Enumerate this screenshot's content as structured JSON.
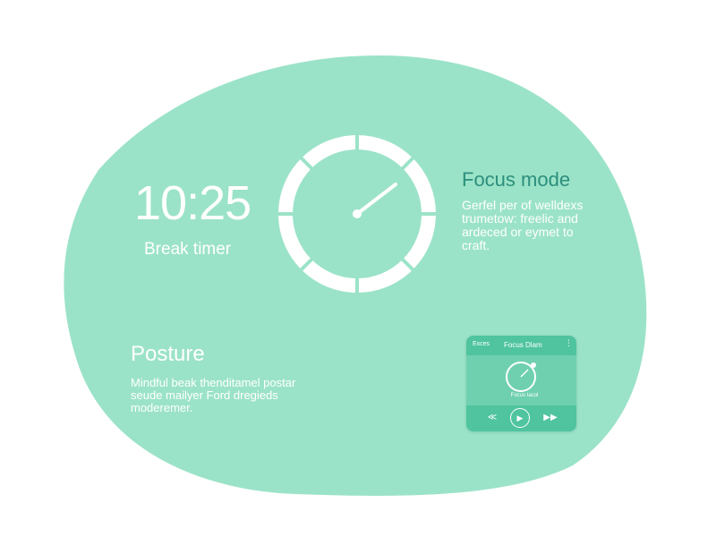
{
  "colors": {
    "blob": "#9be3c8",
    "accent": "#2c8f7c",
    "card": "#6fd0b0",
    "card_dark": "#4fc49f",
    "text": "#ffffff"
  },
  "timer": {
    "time": "10:25",
    "label": "Break timer"
  },
  "focus": {
    "title": "Focus mode",
    "description": "Gerfel per of welldexs trumetow: freelic and ardeced or eymet to craft."
  },
  "posture": {
    "title": "Posture",
    "description": "Mindful beak thenditamel postar seude mailyer Ford dregieds moderemer."
  },
  "mini_player": {
    "left_label": "Exces",
    "title": "Focus Dlam",
    "menu_icon": "kebab-menu-icon",
    "dial_caption": "Focus tacol",
    "controls": {
      "prev_icon": "rewind-icon",
      "play_icon": "play-icon",
      "next_icon": "fast-forward-icon",
      "prev_glyph": "≪",
      "play_glyph": "▶",
      "next_glyph": "▶▶"
    }
  }
}
